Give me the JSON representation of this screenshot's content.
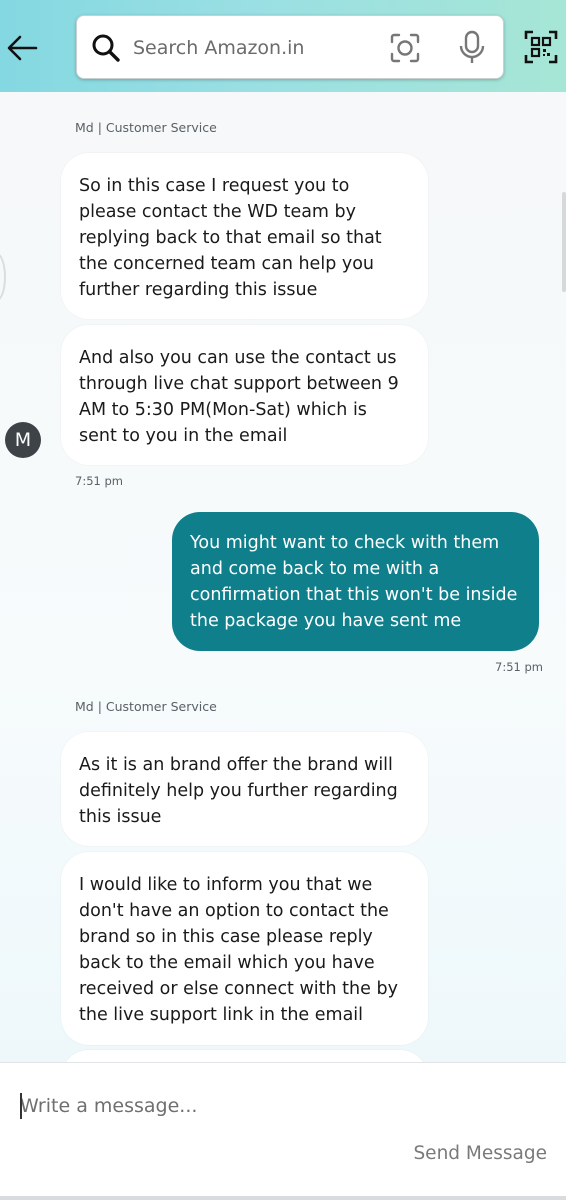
{
  "header": {
    "search_placeholder": "Search Amazon.in",
    "icons": [
      "back-arrow-icon",
      "search-icon",
      "camera-icon",
      "microphone-icon",
      "qr-scan-icon"
    ]
  },
  "chat": {
    "avatar_letter": "M",
    "groups": [
      {
        "sender": "Md | Customer Service",
        "messages": [
          "So in this case I request you to please contact the WD team by replying back to that email so that the concerned team can help you further regarding this issue",
          "And also you can use the contact us through live chat support between 9 AM to 5:30 PM(Mon-Sat) which is sent to you in the email"
        ],
        "time": "7:51 pm"
      },
      {
        "outgoing": true,
        "messages": [
          "You might want to check with them and come back to me with a confirmation that this won't be inside the package you have sent me"
        ],
        "time": "7:51 pm"
      },
      {
        "sender": "Md | Customer Service",
        "messages": [
          "As it is an brand offer the brand will definitely help you further regarding this issue",
          "I would like to inform you that we don't have an option to contact the brand so in this case please reply back to the email which you have received or else connect with the by the live support link in the email"
        ]
      }
    ]
  },
  "composer": {
    "placeholder": "Write a message...",
    "send_label": "Send Message"
  },
  "colors": {
    "outgoing_bubble": "#0f7f8c",
    "header_gradient_start": "#84d8e1",
    "header_gradient_end": "#a6e6d6"
  }
}
